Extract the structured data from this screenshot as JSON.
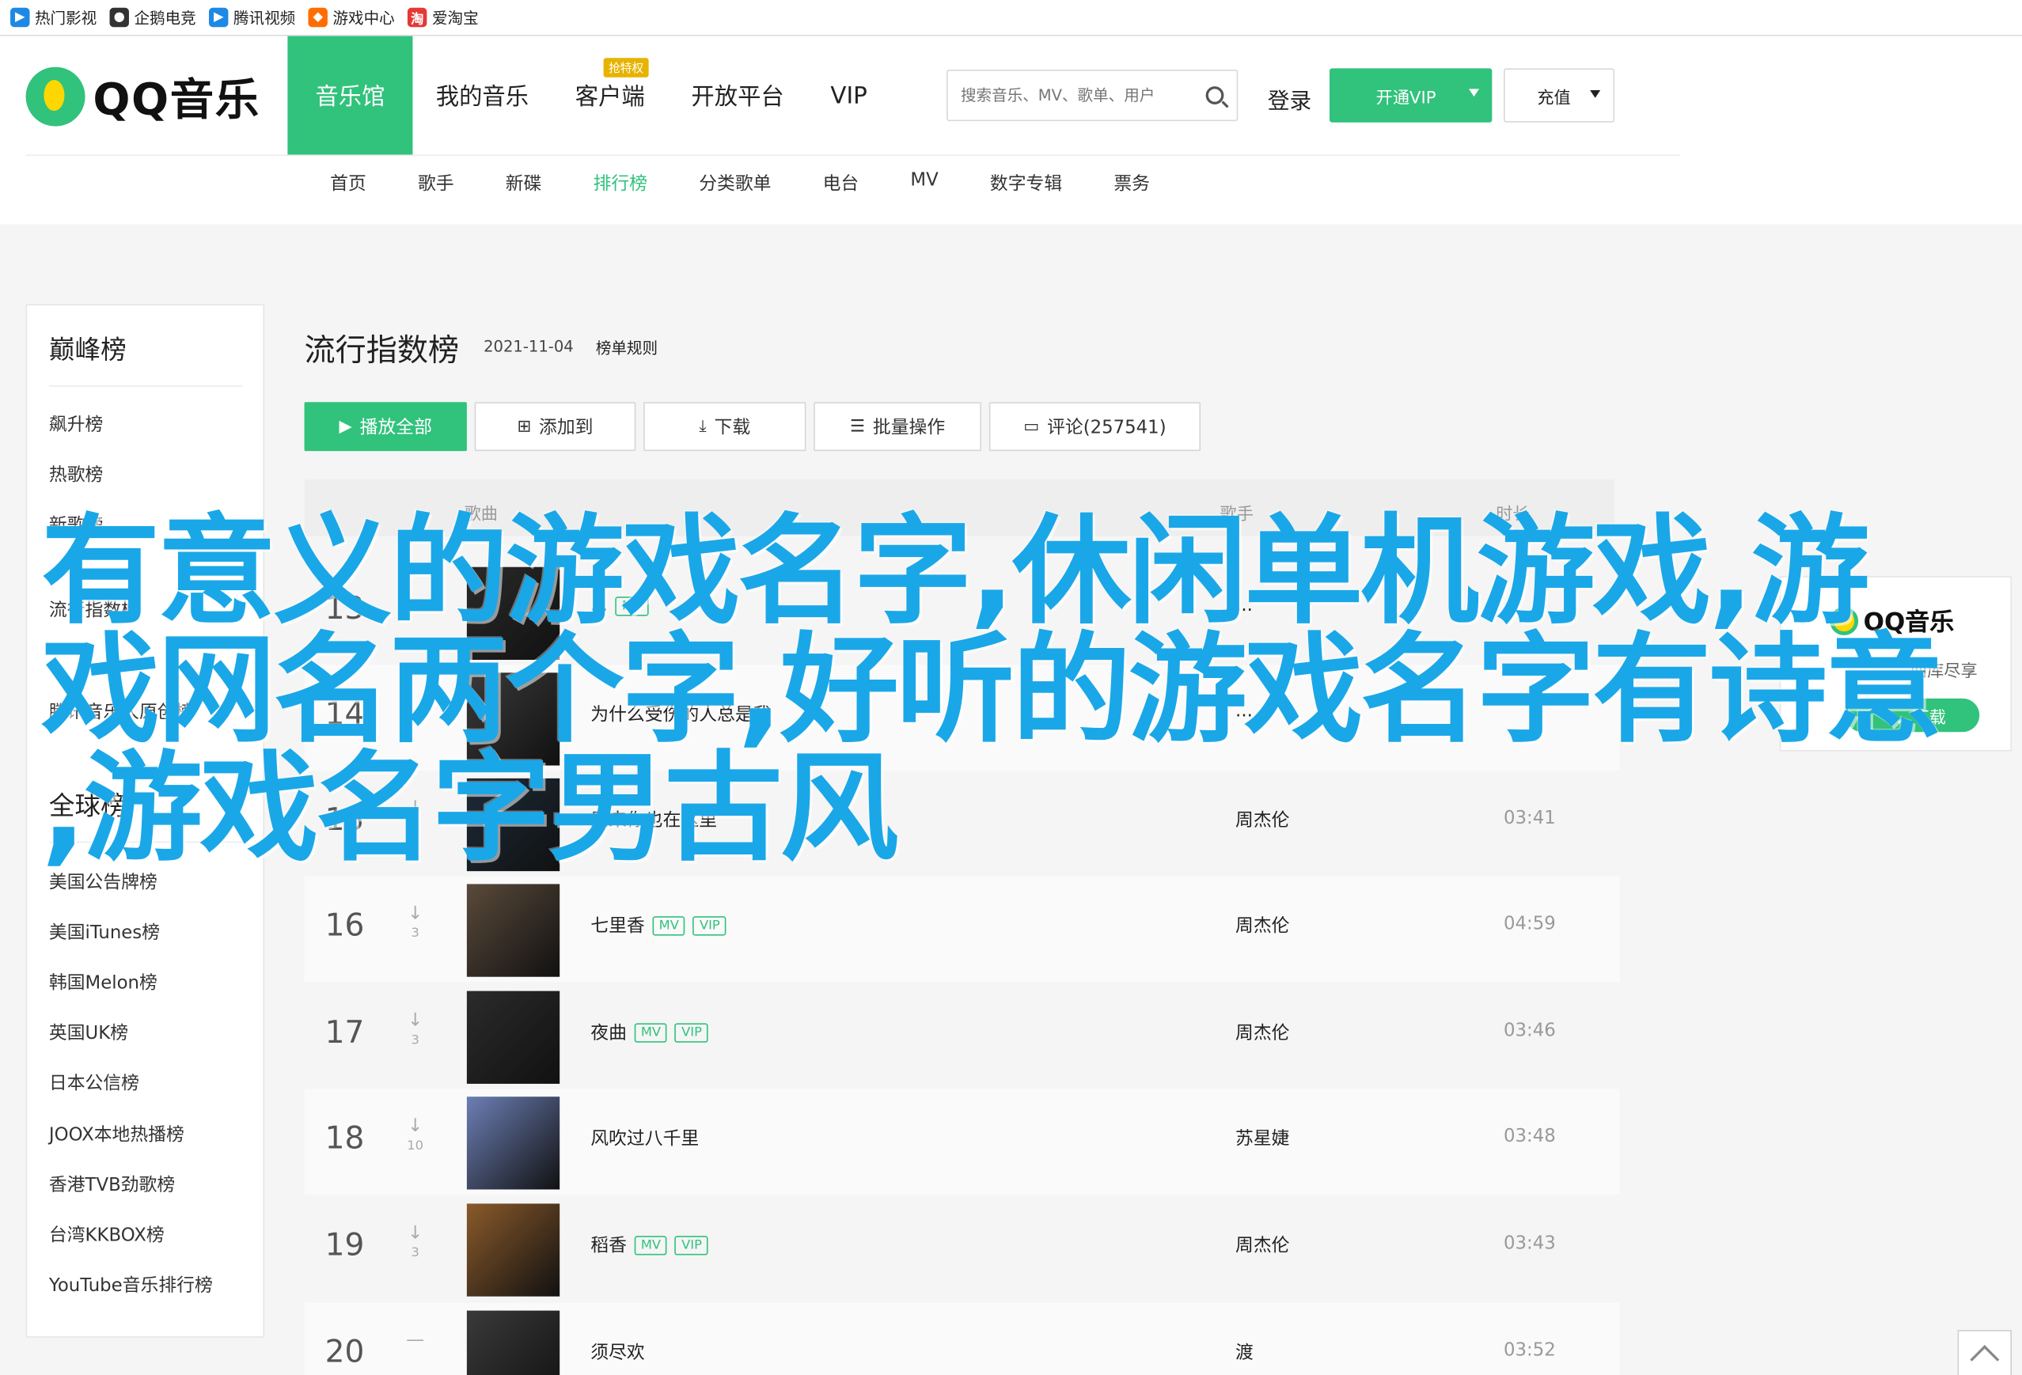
{
  "bookmarks": [
    "热门影视",
    "企鹅电竞",
    "腾讯视频",
    "游戏中心",
    "爱淘宝"
  ],
  "header": {
    "logo_text": "QQ音乐",
    "main_nav": [
      "音乐馆",
      "我的音乐",
      "客户端",
      "开放平台",
      "VIP"
    ],
    "client_badge": "抢特权",
    "search_placeholder": "搜索音乐、MV、歌单、用户",
    "login": "登录",
    "vip_button": "开通VIP",
    "recharge_button": "充值",
    "sub_nav": [
      "首页",
      "歌手",
      "新碟",
      "排行榜",
      "分类歌单",
      "电台",
      "MV",
      "数字专辑",
      "票务"
    ],
    "active_sub_nav": "排行榜"
  },
  "sidebar": {
    "section1_title": "巅峰榜",
    "section1_items": [
      "飙升榜",
      "热歌榜",
      "新歌榜",
      "流行指数榜",
      "腾讯音乐人原创榜"
    ],
    "section2_title": "全球榜",
    "section2_items": [
      "美国公告牌榜",
      "美国iTunes榜",
      "韩国Melon榜",
      "英国UK榜",
      "日本公信榜",
      "JOOX本地热播榜",
      "香港TVB劲歌榜",
      "台湾KKBOX榜",
      "YouTube音乐排行榜"
    ]
  },
  "main": {
    "title": "流行指数榜",
    "date": "2021-11-04",
    "rule_link": "榜单规则",
    "toolbar": {
      "play_all": "播放全部",
      "add_to": "添加到",
      "download": "下载",
      "batch": "批量操作",
      "comments": "评论(257541)"
    },
    "table_head": {
      "song": "歌曲",
      "singer": "歌手",
      "duration": "时长"
    },
    "rows": [
      {
        "rank": "13",
        "trend": "",
        "trend_num": "",
        "song": "...",
        "singer": "...",
        "duration": "",
        "tags": [
          "MV"
        ]
      },
      {
        "rank": "14",
        "trend": "",
        "trend_num": "",
        "song": "为什么受伤的人总是我",
        "singer": "...",
        "duration": "",
        "tags": []
      },
      {
        "rank": "15",
        "trend": "↓",
        "trend_num": "9",
        "song": "原来你也在这里",
        "singer": "周杰伦",
        "duration": "03:41",
        "tags": []
      },
      {
        "rank": "16",
        "trend": "↓",
        "trend_num": "3",
        "song": "七里香",
        "singer": "周杰伦",
        "duration": "04:59",
        "tags": [
          "MV",
          "VIP"
        ]
      },
      {
        "rank": "17",
        "trend": "↓",
        "trend_num": "3",
        "song": "夜曲",
        "singer": "周杰伦",
        "duration": "03:46",
        "tags": [
          "MV",
          "VIP"
        ]
      },
      {
        "rank": "18",
        "trend": "↓",
        "trend_num": "10",
        "song": "风吹过八千里",
        "singer": "苏星婕",
        "duration": "03:48",
        "tags": []
      },
      {
        "rank": "19",
        "trend": "↓",
        "trend_num": "3",
        "song": "稻香",
        "singer": "周杰伦",
        "duration": "03:43",
        "tags": [
          "MV",
          "VIP"
        ]
      },
      {
        "rank": "20",
        "trend": "—",
        "trend_num": "",
        "song": "须尽欢",
        "singer": "渡",
        "duration": "03:52",
        "tags": []
      }
    ]
  },
  "ad": {
    "logo_text": "QQ音乐",
    "subtitle": "...曲库尽享",
    "button": "...下载"
  },
  "overlay_lines": [
    "有意义的游戏名字,休闲单机游戏,游",
    "戏网名两个字,好听的游戏名字有诗意",
    ",游戏名字男古风"
  ],
  "colors": {
    "brand": "#31c27c",
    "overlay": "#1aa7e8"
  }
}
